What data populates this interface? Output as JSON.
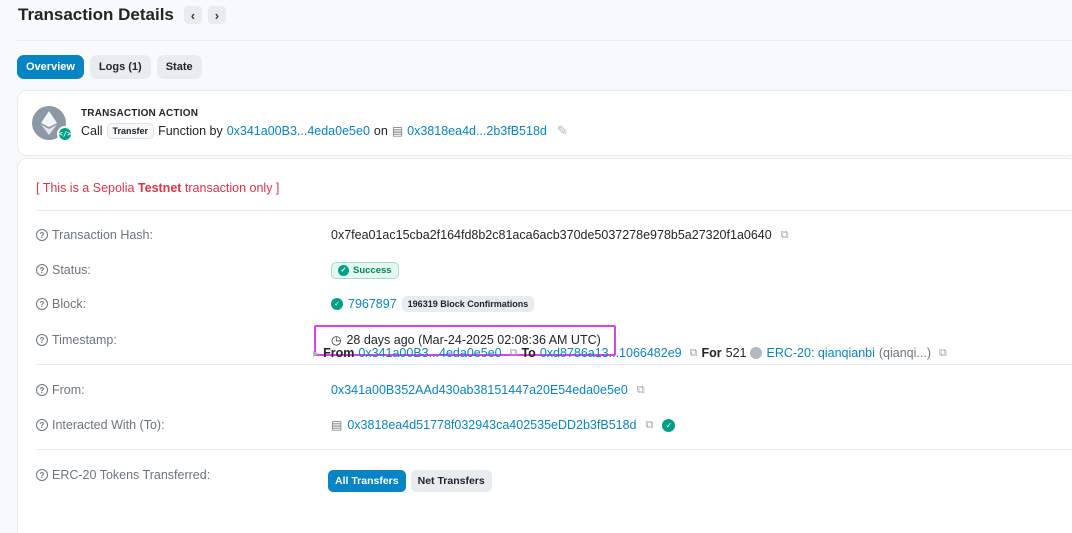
{
  "header": {
    "title": "Transaction Details",
    "prev_icon": "chevron-left",
    "next_icon": "chevron-right"
  },
  "tabs": [
    {
      "label": "Overview",
      "active": true
    },
    {
      "label": "Logs (1)",
      "active": false
    },
    {
      "label": "State",
      "active": false
    }
  ],
  "action": {
    "heading": "TRANSACTION ACTION",
    "call": "Call",
    "method": "Transfer",
    "function_by": "Function by",
    "from_short": "0x341a00B3...4eda0e5e0",
    "on": "on",
    "contract_short": "0x3818ea4d...2b3fB518d"
  },
  "warning": {
    "prefix": "[ This is a Sepolia ",
    "bold": "Testnet",
    "suffix": " transaction only ]"
  },
  "details": {
    "hash": {
      "label": "Transaction Hash:",
      "value": "0x7fea01ac15cba2f164fd8b2c81aca6acb370de5037278e978b5a27320f1a0640"
    },
    "status": {
      "label": "Status:",
      "value": "Success"
    },
    "block": {
      "label": "Block:",
      "number": "7967897",
      "confirmations": "196319 Block Confirmations"
    },
    "timestamp": {
      "label": "Timestamp:",
      "value": "28 days ago (Mar-24-2025 02:08:36 AM UTC)"
    },
    "from": {
      "label": "From:",
      "value": "0x341a00B352AAd430ab38151447a20E54eda0e5e0"
    },
    "to": {
      "label": "Interacted With (To):",
      "value": "0x3818ea4d51778f032943ca402535eDD2b3fB518d"
    },
    "erc20": {
      "label": "ERC-20 Tokens Transferred:",
      "all_btn": "All Transfers",
      "net_btn": "Net Transfers",
      "from_label": "From",
      "from_value": "0x341a00B3...4eda0e5e0",
      "to_label": "To",
      "to_value": "0xd8786a13...1066482e9",
      "for_label": "For",
      "amount": "521",
      "token_name": "ERC-20: qianqianbi",
      "token_symbol": "(qianqi...)"
    }
  },
  "colors": {
    "accent": "#0784c3",
    "success": "#00a186",
    "warning": "#dc3545",
    "highlight": "#e040ea"
  }
}
